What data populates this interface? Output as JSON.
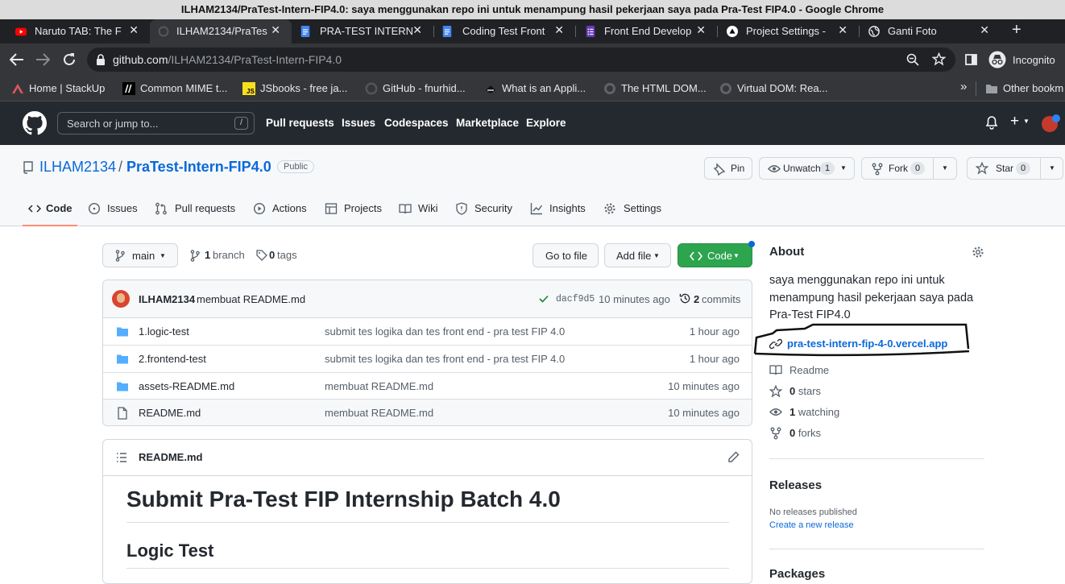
{
  "window": {
    "title": "ILHAM2134/PraTest-Intern-FIP4.0: saya menggunakan repo ini untuk menampung hasil pekerjaan saya pada Pra-Test FIP4.0 - Google Chrome"
  },
  "tabs": [
    {
      "label": "Naruto TAB: The F",
      "icon": "youtube-icon"
    },
    {
      "label": "ILHAM2134/PraTes",
      "icon": "github-icon"
    },
    {
      "label": "PRA-TEST INTERN",
      "icon": "docs-icon"
    },
    {
      "label": "Coding Test Front",
      "icon": "docs-icon"
    },
    {
      "label": "Front End Develop",
      "icon": "forms-icon"
    },
    {
      "label": "Project Settings -",
      "icon": "vercel-icon"
    },
    {
      "label": "Ganti Foto",
      "icon": "globe-icon"
    }
  ],
  "toolbar": {
    "url_host": "github.com",
    "url_path": "/ILHAM2134/PraTest-Intern-FIP4.0",
    "profile_label": "Incognito"
  },
  "bookmarks": [
    {
      "label": "Home | StackUp",
      "icon": "stackup-icon"
    },
    {
      "label": "Common MIME t...",
      "icon": "mdn-icon"
    },
    {
      "label": "JSbooks - free ja...",
      "icon": "js-icon"
    },
    {
      "label": "GitHub - fnurhid...",
      "icon": "github-icon"
    },
    {
      "label": "What is an Appli...",
      "icon": "cloud-icon"
    },
    {
      "label": "The HTML DOM...",
      "icon": "globe-icon"
    },
    {
      "label": "Virtual DOM: Rea...",
      "icon": "globe-icon"
    }
  ],
  "bookmarks_overflow": "»",
  "other_bookmarks": "Other bookm",
  "gh": {
    "search_placeholder": "Search or jump to...",
    "search_shortcut": "/",
    "nav": [
      "Pull requests",
      "Issues",
      "Codespaces",
      "Marketplace",
      "Explore"
    ]
  },
  "repo": {
    "owner": "ILHAM2134",
    "sep": "/",
    "name": "PraTest-Intern-FIP4.0",
    "visibility": "Public",
    "pin_label": "Pin",
    "unwatch_label": "Unwatch",
    "unwatch_count": "1",
    "fork_label": "Fork",
    "fork_count": "0",
    "star_label": "Star",
    "star_count": "0"
  },
  "repo_tabs": [
    {
      "label": "Code",
      "icon": "code-icon"
    },
    {
      "label": "Issues",
      "icon": "issue-icon"
    },
    {
      "label": "Pull requests",
      "icon": "pr-icon"
    },
    {
      "label": "Actions",
      "icon": "play-icon"
    },
    {
      "label": "Projects",
      "icon": "table-icon"
    },
    {
      "label": "Wiki",
      "icon": "book-icon"
    },
    {
      "label": "Security",
      "icon": "shield-icon"
    },
    {
      "label": "Insights",
      "icon": "graph-icon"
    },
    {
      "label": "Settings",
      "icon": "gear-icon"
    }
  ],
  "branch_bar": {
    "branch": "main",
    "branch_count": "1",
    "branch_word": "branch",
    "tag_count": "0",
    "tag_word": "tags",
    "goto_file": "Go to file",
    "add_file": "Add file",
    "code": "Code"
  },
  "commit": {
    "author": "ILHAM2134",
    "message": "membuat README.md",
    "sha": "dacf9d5",
    "age": "10 minutes ago",
    "commit_count": "2",
    "commit_word": "commits"
  },
  "files": [
    {
      "type": "dir",
      "name": "1.logic-test",
      "message": "submit tes logika dan tes front end - pra test FIP 4.0",
      "age": "1 hour ago"
    },
    {
      "type": "dir",
      "name": "2.frontend-test",
      "message": "submit tes logika dan tes front end - pra test FIP 4.0",
      "age": "1 hour ago"
    },
    {
      "type": "dir",
      "name": "assets-README.md",
      "message": "membuat README.md",
      "age": "10 minutes ago"
    },
    {
      "type": "file",
      "name": "README.md",
      "message": "membuat README.md",
      "age": "10 minutes ago"
    }
  ],
  "readme": {
    "filename": "README.md",
    "h1": "Submit Pra-Test FIP Internship Batch 4.0",
    "h2": "Logic Test"
  },
  "about": {
    "heading": "About",
    "description": "saya menggunakan repo ini untuk menampung hasil pekerjaan saya pada Pra-Test FIP4.0",
    "website": "pra-test-intern-fip-4-0.vercel.app",
    "readme": "Readme",
    "stars_count": "0",
    "stars_word": "stars",
    "watching_count": "1",
    "watching_word": "watching",
    "forks_count": "0",
    "forks_word": "forks"
  },
  "releases": {
    "heading": "Releases",
    "none": "No releases published",
    "create": "Create a new release"
  },
  "packages": {
    "heading": "Packages"
  },
  "colors": {
    "accent_link": "#0969da",
    "code_button": "#2da44e",
    "tab_underline": "#fd8c73",
    "gh_header": "#24292f"
  }
}
